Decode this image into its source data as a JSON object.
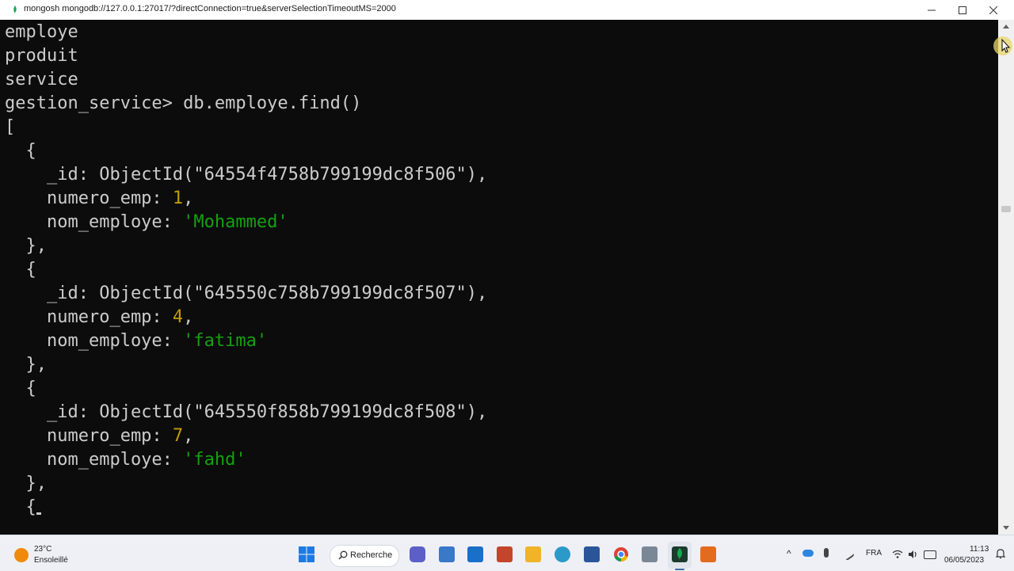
{
  "window": {
    "title": "mongosh mongodb://127.0.0.1:27017/?directConnection=true&serverSelectionTimeoutMS=2000"
  },
  "terminal": {
    "lines": [
      {
        "text": "employe"
      },
      {
        "text": "produit"
      },
      {
        "text": "service"
      },
      {
        "prompt": "gestion_service> ",
        "command": "db.employe.find()"
      },
      {
        "text": "["
      },
      {
        "text": "  {"
      },
      {
        "key": "    _id: ",
        "val": "ObjectId(\"64554f4758b799199dc8f506\"),",
        "kind": "plain"
      },
      {
        "key": "    numero_emp: ",
        "val": "1",
        "suffix": ",",
        "kind": "num"
      },
      {
        "key": "    nom_employe: ",
        "val": "'Mohammed'",
        "kind": "str"
      },
      {
        "text": "  },"
      },
      {
        "text": "  {"
      },
      {
        "key": "    _id: ",
        "val": "ObjectId(\"645550c758b799199dc8f507\"),",
        "kind": "plain"
      },
      {
        "key": "    numero_emp: ",
        "val": "4",
        "suffix": ",",
        "kind": "num"
      },
      {
        "key": "    nom_employe: ",
        "val": "'fatima'",
        "kind": "str"
      },
      {
        "text": "  },"
      },
      {
        "text": "  {"
      },
      {
        "key": "    _id: ",
        "val": "ObjectId(\"645550f858b799199dc8f508\"),",
        "kind": "plain"
      },
      {
        "key": "    numero_emp: ",
        "val": "7",
        "suffix": ",",
        "kind": "num"
      },
      {
        "key": "    nom_employe: ",
        "val": "'fahd'",
        "kind": "str"
      },
      {
        "text": "  },"
      },
      {
        "text": "  {"
      }
    ]
  },
  "taskbar": {
    "weather_temp": "23°C",
    "weather_desc": "Ensoleillé",
    "search_label": "Recherche",
    "language": "FRA",
    "time": "11:13",
    "date": "06/05/2023"
  },
  "colors": {
    "terminal_bg": "#0c0c0c",
    "text": "#cccccc",
    "number": "#c19c00",
    "string": "#13a10e"
  }
}
